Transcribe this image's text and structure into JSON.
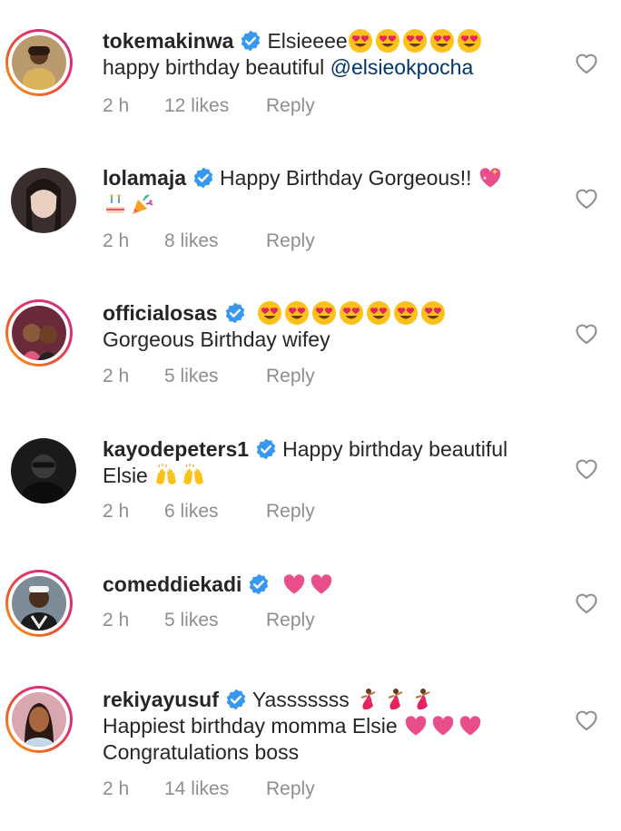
{
  "ui": {
    "verified_color": "#3897f0",
    "meta_color": "#8e8e8e",
    "mention_color": "#00376b",
    "like_icon": "heart-outline-icon",
    "verified_icon": "verified-badge-icon"
  },
  "comments": [
    {
      "username": "tokemakinwa",
      "text_line1": "Elsieeee",
      "emojis_line1": [
        "heart-eyes",
        "heart-eyes",
        "heart-eyes",
        "heart-eyes",
        "heart-eyes"
      ],
      "text_line2": "happy birthday beautiful ",
      "mention": "@elsieokpocha",
      "time": "2 h",
      "likes": "12 likes",
      "reply": "Reply"
    },
    {
      "username": "lolamaja",
      "text_line1": "Happy Birthday Gorgeous!!",
      "emojis_line1": [
        "sparkling-heart"
      ],
      "emojis_line2": [
        "birthday-cake",
        "party-popper"
      ],
      "time": "2 h",
      "likes": "8 likes",
      "reply": "Reply"
    },
    {
      "username": "officialosas",
      "emojis_line1": [
        "heart-eyes",
        "heart-eyes",
        "heart-eyes",
        "heart-eyes",
        "heart-eyes",
        "heart-eyes",
        "heart-eyes"
      ],
      "text_line2": "Gorgeous Birthday wifey",
      "time": "2 h",
      "likes": "5 likes",
      "reply": "Reply"
    },
    {
      "username": "kayodepeters1",
      "text_line1": "Happy birthday beautiful",
      "text_line2": "Elsie ",
      "emojis_line2": [
        "raising-hands",
        "raising-hands"
      ],
      "time": "2 h",
      "likes": "6 likes",
      "reply": "Reply"
    },
    {
      "username": "comeddiekadi",
      "emojis_line1": [
        "pink-heart",
        "pink-heart"
      ],
      "time": "2 h",
      "likes": "5 likes",
      "reply": "Reply"
    },
    {
      "username": "rekiyayusuf",
      "text_line1": "Yasssssss ",
      "emojis_line1": [
        "dancer",
        "dancer",
        "dancer"
      ],
      "text_line2": "Happiest birthday momma Elsie ",
      "emojis_line2": [
        "pink-heart",
        "pink-heart",
        "pink-heart"
      ],
      "text_line3": "Congratulations boss",
      "time": "2 h",
      "likes": "14 likes",
      "reply": "Reply"
    }
  ]
}
